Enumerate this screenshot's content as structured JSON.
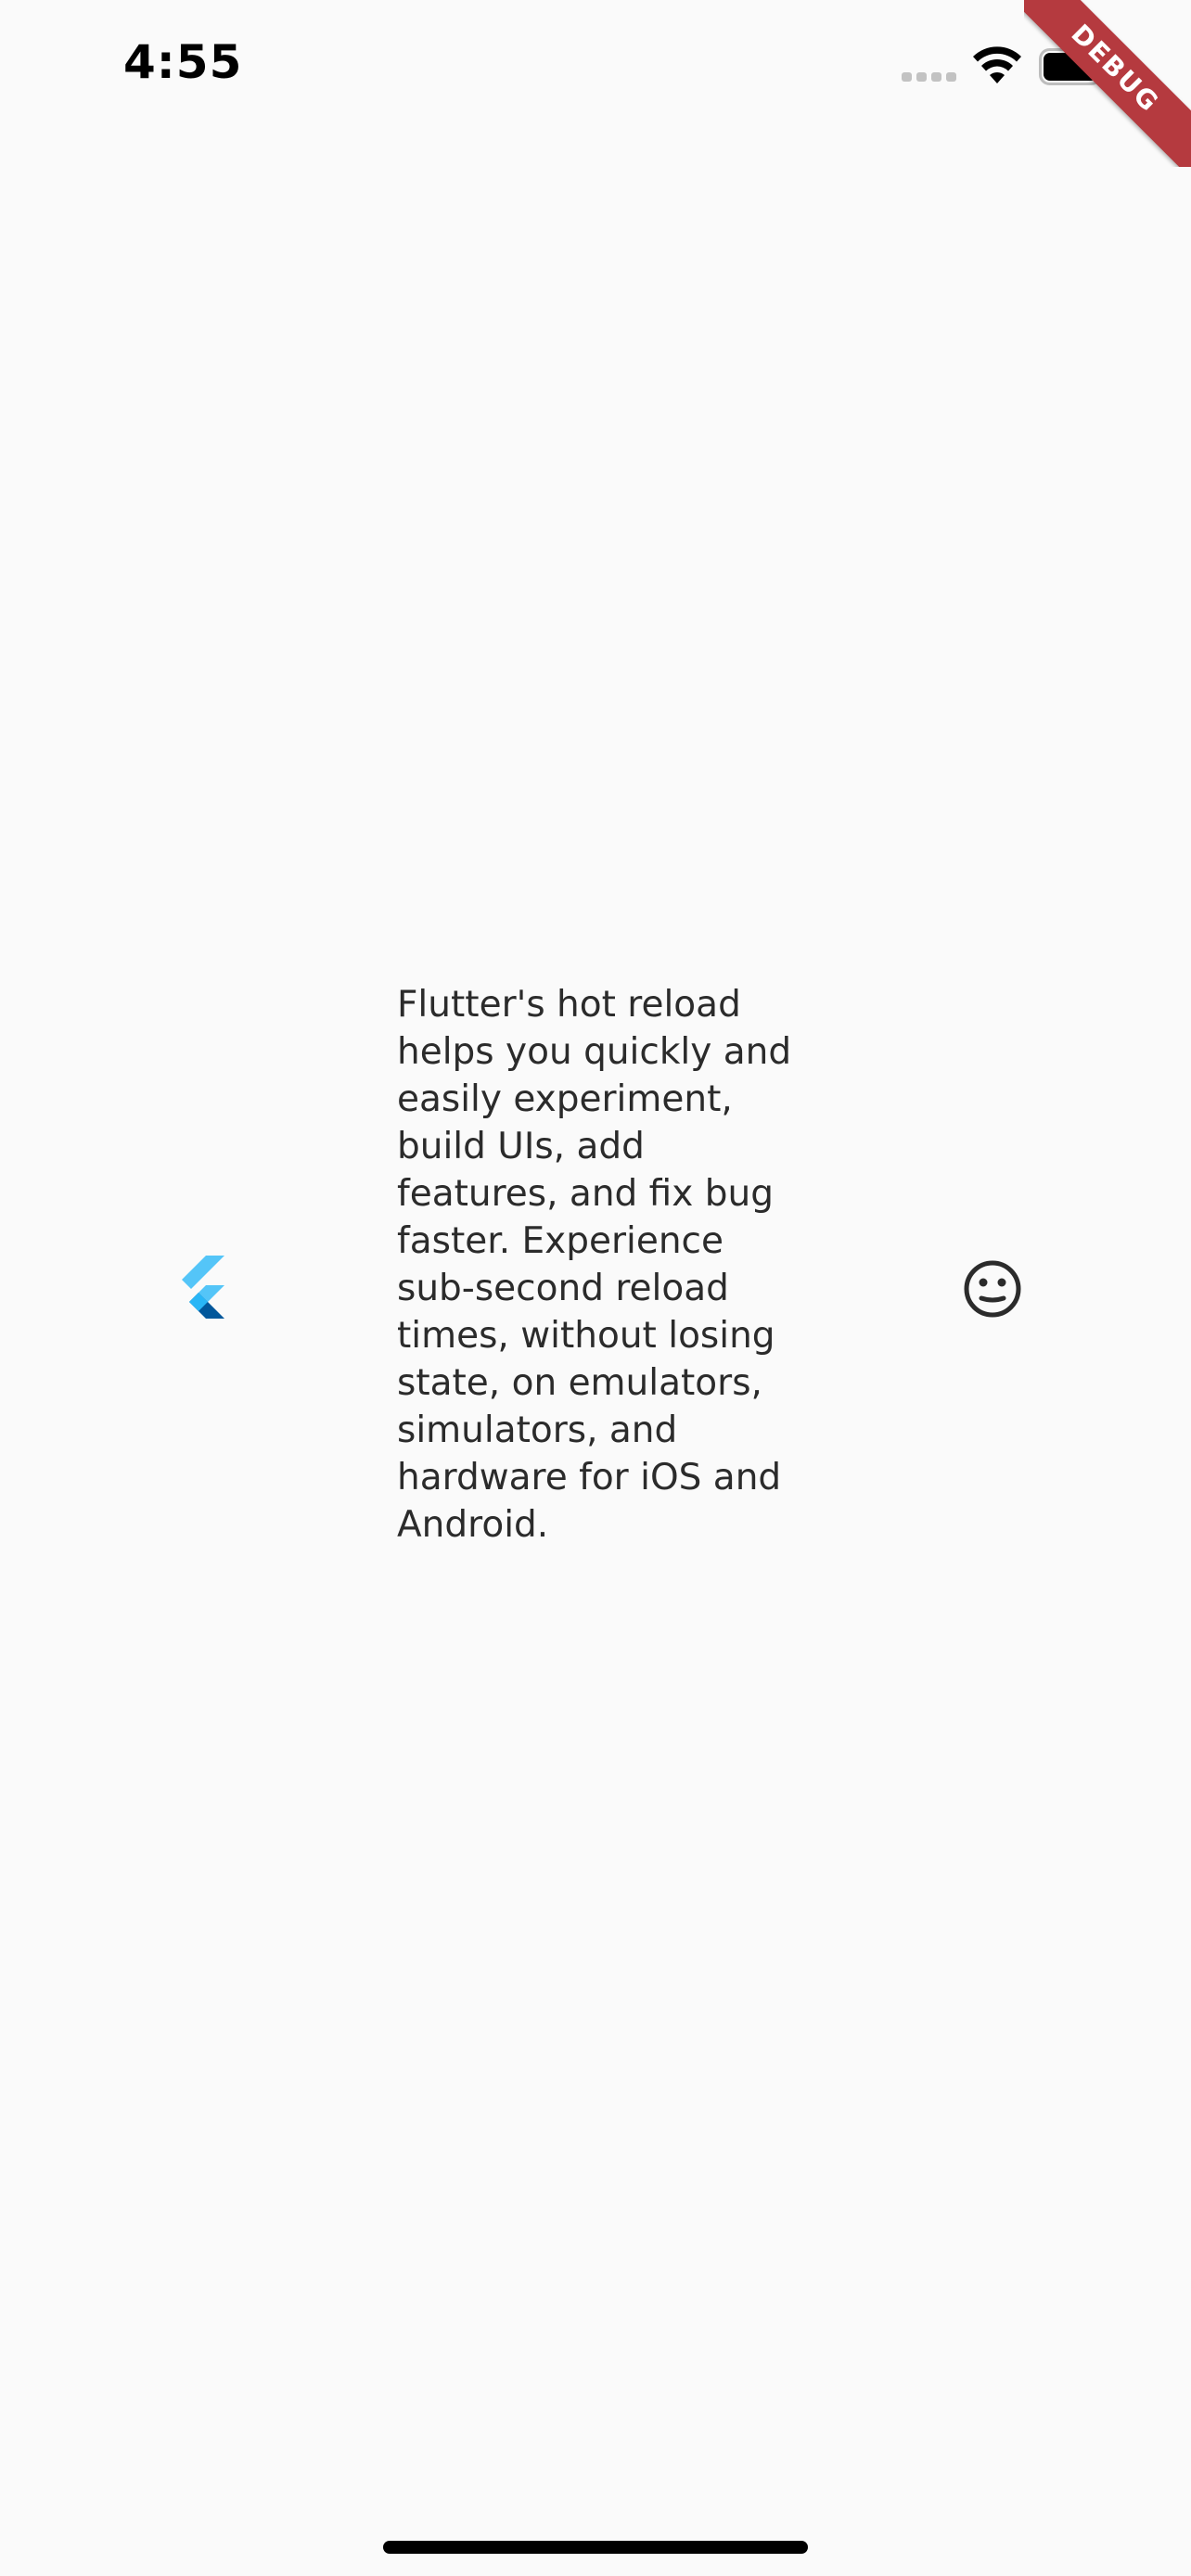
{
  "status_bar": {
    "time": "4:55",
    "signal_icon": "cellular-signal-icon",
    "wifi_icon": "wifi-icon",
    "battery_icon": "battery-icon"
  },
  "debug_banner": {
    "label": "DEBUG",
    "color": "#b53a3f"
  },
  "main": {
    "leading_icon": "flutter-logo-icon",
    "body_text": "Flutter's hot reload helps you quickly and easily experiment, build UIs, add features, and fix bug faster. Experience sub-second reload times, without losing state, on emulators, simulators, and hardware for iOS and Android.",
    "trailing_icon": "sentiment-neutral-icon"
  },
  "colors": {
    "background": "#fafafa",
    "text": "#2b2b2b",
    "flutter_light_blue": "#54c5f8",
    "flutter_dark_blue": "#01579b"
  }
}
